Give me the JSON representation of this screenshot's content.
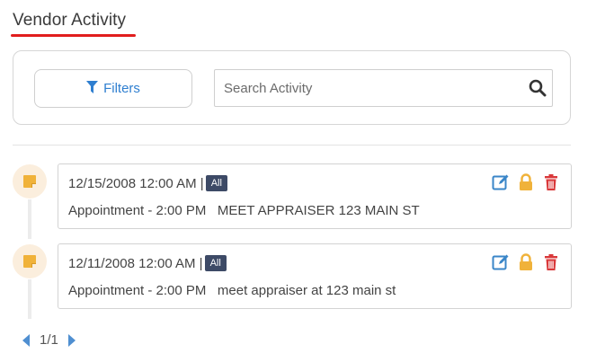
{
  "header": {
    "title": "Vendor Activity"
  },
  "filters": {
    "button_label": "Filters",
    "icon": "funnel-icon"
  },
  "search": {
    "placeholder": "Search Activity",
    "value": "",
    "icon": "search-icon"
  },
  "activities": [
    {
      "datetime": "12/15/2008 12:00 AM |",
      "badge": "All",
      "summary": "Appointment - 2:00 PM   MEET APPRAISER 123 MAIN ST"
    },
    {
      "datetime": "12/11/2008 12:00 AM |",
      "badge": "All",
      "summary": "Appointment - 2:00 PM   meet appraiser at 123 main st"
    }
  ],
  "pagination": {
    "label": "1/1"
  },
  "colors": {
    "accent_blue": "#2f7fd0",
    "title_underline": "#e11d1d",
    "badge_bg": "#3d4a66",
    "lock": "#f0b23a",
    "delete": "#d9383a",
    "edit": "#3a86c8"
  }
}
